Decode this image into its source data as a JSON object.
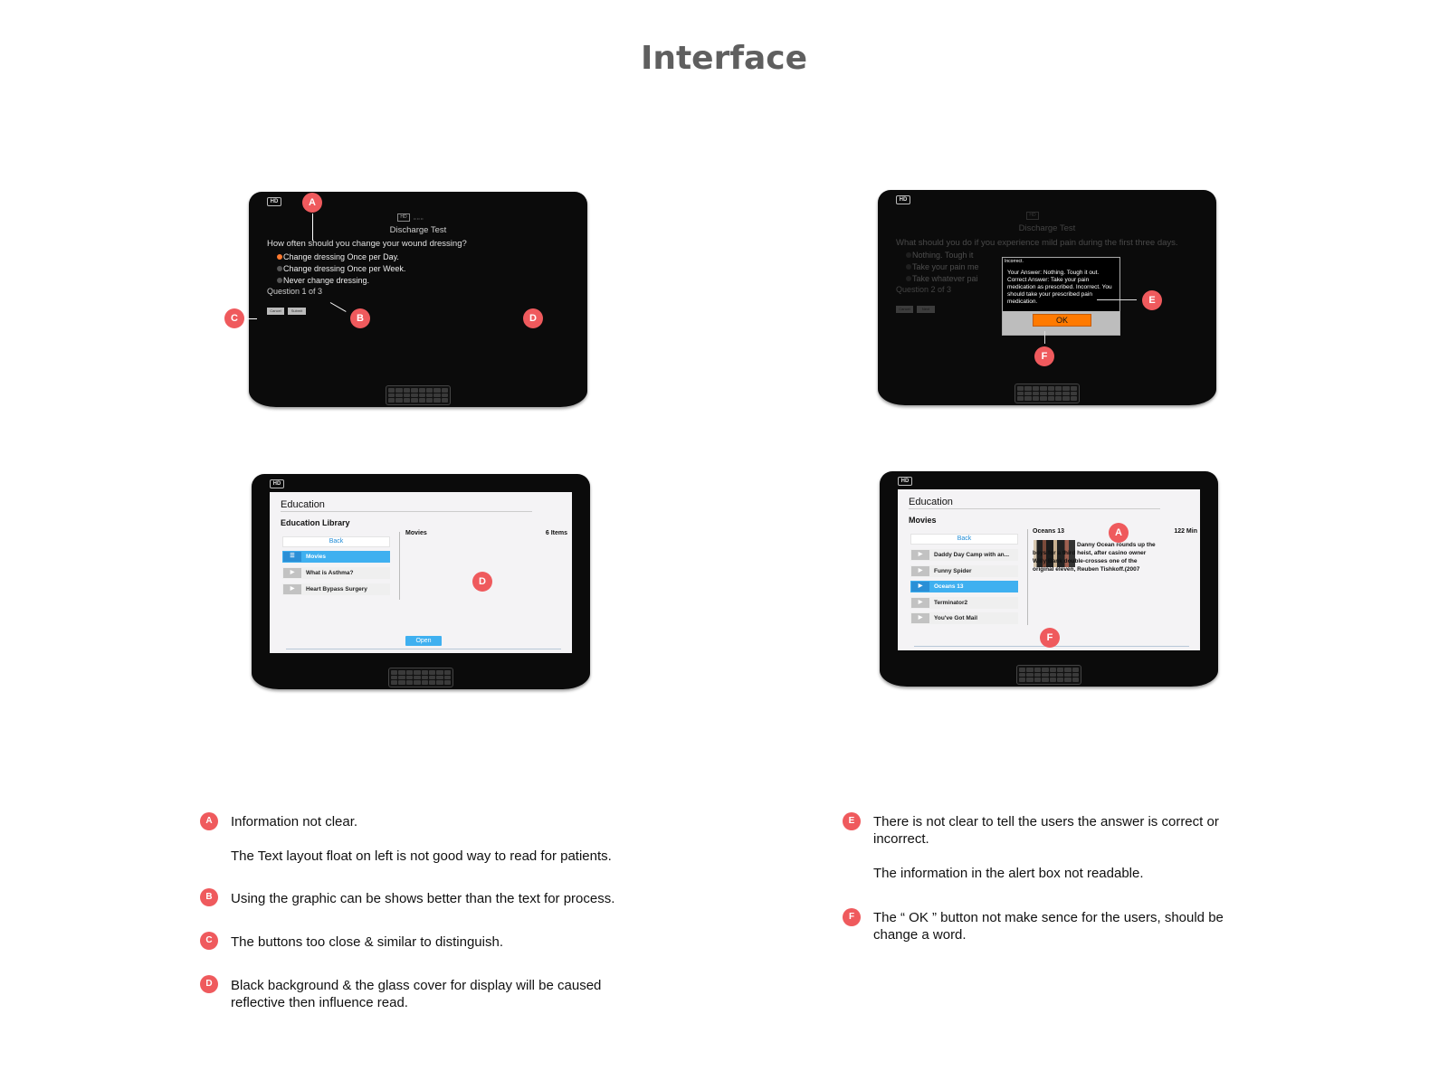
{
  "page": {
    "title": "Interface"
  },
  "device": {
    "logo": "HD"
  },
  "screen1": {
    "title": "Discharge Test",
    "question": "How often should you change your wound dressing?",
    "options": [
      "Change dressing Once per Day.",
      "Change dressing Once per Week.",
      "Never change dressing."
    ],
    "count": "Question 1 of 3",
    "cancel": "Cancel",
    "submit": "Submit",
    "markers": [
      "A",
      "B",
      "C",
      "D"
    ]
  },
  "screen2": {
    "title": "Discharge Test",
    "question": "What should you do if you experience mild pain during the first three days.",
    "options": [
      "Nothing.  Tough it",
      "Take your pain me",
      "Take whatever pai"
    ],
    "count": "Question 2 of 3",
    "cancel": "Cancel",
    "next": "Next",
    "dialog": {
      "header": "Incorrect.",
      "body": "Your Answer: Nothing.  Tough it out. Correct Answer: Take your pain medication as prescribed. Incorrect. You should take your prescribed pain medication.",
      "ok": "OK"
    },
    "markers": [
      "E",
      "F"
    ]
  },
  "screen3": {
    "title": "Education",
    "subtitle": "Education Library",
    "back": "Back",
    "items": [
      "Movies",
      "What is Asthma?",
      "Heart Bypass Surgery"
    ],
    "panel_title": "Movies",
    "panel_count": "6 Items",
    "open": "Open",
    "markers": [
      "D"
    ]
  },
  "screen4": {
    "title": "Education",
    "subtitle": "Movies",
    "back": "Back",
    "items": [
      "Daddy Day Camp with an...",
      "Funny Spider",
      "Oceans 13",
      "Terminator2",
      "You've Got Mail"
    ],
    "movie_title": "Oceans 13",
    "duration": "122 Min",
    "description": "Danny Ocean rounds up the boys for a third heist, after casino owner Willy Bank double-crosses one of the original eleven, Reuben Tishkoff.(2007",
    "markers": [
      "A",
      "F"
    ]
  },
  "notes": {
    "left": [
      {
        "marker": "A",
        "lines": [
          "Information not clear.",
          "The Text layout float on left is not good way to read for patients."
        ]
      },
      {
        "marker": "B",
        "lines": [
          "Using the graphic can be shows better than the text for process."
        ]
      },
      {
        "marker": "C",
        "lines": [
          "The buttons too close & similar to distinguish."
        ]
      },
      {
        "marker": "D",
        "lines": [
          "Black background & the glass cover for display will be caused",
          "reflective then influence read."
        ]
      }
    ],
    "right": [
      {
        "marker": "E",
        "lines": [
          "There is not clear to tell the users the answer is correct or",
          "incorrect.",
          "The information in the alert box not readable."
        ]
      },
      {
        "marker": "F",
        "lines": [
          "The “ OK ” button not make sence for the users, should be",
          "change a word."
        ]
      }
    ]
  },
  "colors": {
    "marker": "#ef5a5d",
    "title": "#5f5f5f",
    "ok_button": "#ff7a00",
    "selected": "#3fb0f0"
  }
}
